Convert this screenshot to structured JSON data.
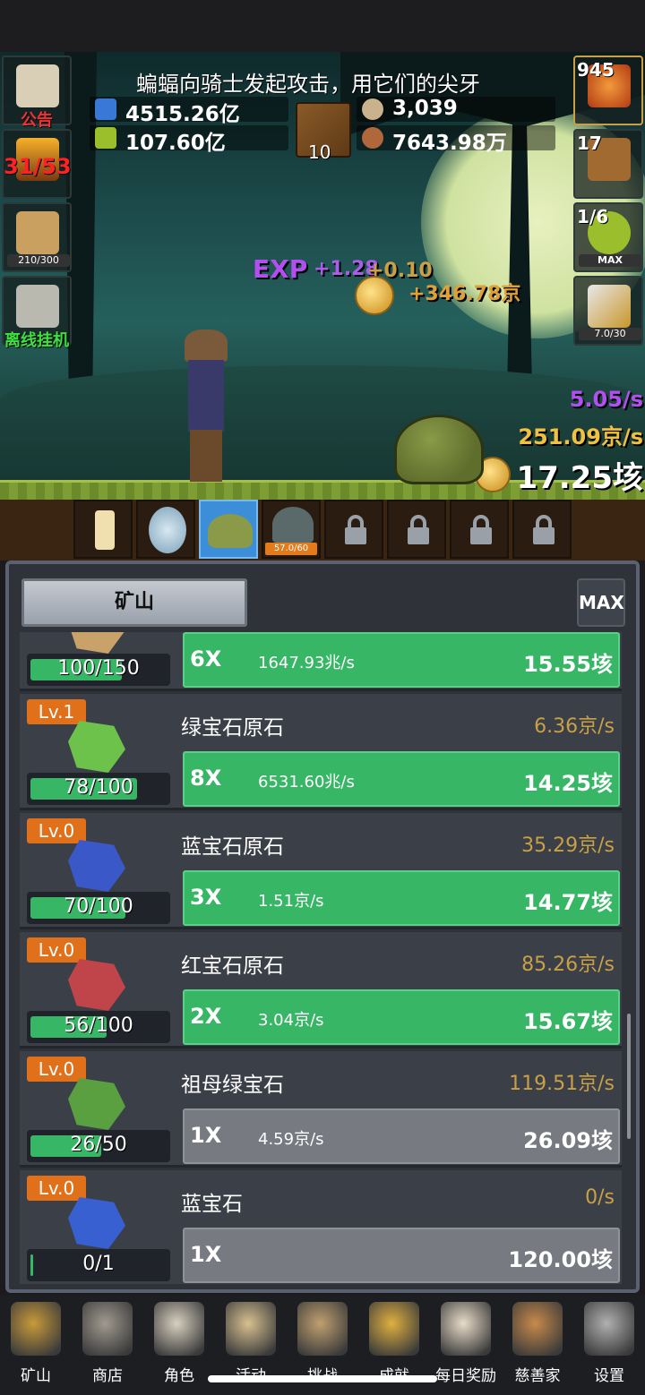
{
  "scene": {
    "message": "蝙蝠向骑士发起攻击，用它们的尖牙",
    "resources": [
      {
        "icon": "blue-potion-icon",
        "value": "4515.26亿"
      },
      {
        "icon": "green-potion-icon",
        "value": "107.60亿"
      },
      {
        "icon": "coin-icon",
        "value": "3,039"
      },
      {
        "icon": "meat-icon",
        "value": "7643.98万"
      }
    ],
    "book_count": "10",
    "left_buttons": [
      {
        "icon": "scroll-icon",
        "label": "公告"
      },
      {
        "icon": "torch-icon",
        "label": "31/53"
      },
      {
        "icon": "beer-icon",
        "label": "210/300"
      },
      {
        "icon": "key-icon",
        "label": "离线挂机"
      }
    ],
    "right_buttons": [
      {
        "icon": "potion-icon",
        "label": "945"
      },
      {
        "icon": "chest-icon",
        "label": "17"
      },
      {
        "icon": "slime-icon",
        "label": "1/6",
        "sub": "MAX"
      },
      {
        "icon": "sword-icon",
        "label": "7.0/30"
      }
    ],
    "floating": {
      "exp_label": "EXP",
      "exp_gain": "+1.28",
      "coin_gain": "+0.10",
      "gold_gain": "+346.78京"
    },
    "rates": {
      "exp_rate": "5.05/s",
      "gold_rate": "251.09京/s",
      "total": "17.25垓"
    },
    "monsters": [
      {
        "name": "candle",
        "locked": false,
        "active": false
      },
      {
        "name": "egg",
        "locked": false,
        "active": false
      },
      {
        "name": "slime",
        "locked": false,
        "active": true
      },
      {
        "name": "ghost",
        "locked": false,
        "active": false,
        "hp": "57.0/60"
      },
      {
        "name": "locked",
        "locked": true
      },
      {
        "name": "locked",
        "locked": true
      },
      {
        "name": "locked",
        "locked": true
      },
      {
        "name": "locked",
        "locked": true
      }
    ]
  },
  "panel": {
    "tab_label": "矿山",
    "max_label": "MAX",
    "rows": [
      {
        "lv": "",
        "name": "",
        "rate": "",
        "progress": "100/150",
        "progress_frac": 0.67,
        "mult": "6X",
        "per": "1647.93兆/s",
        "cost": "15.55垓",
        "state": "green",
        "gem_color": "#c9a26a"
      },
      {
        "lv": "Lv.1",
        "name": "绿宝石原石",
        "rate": "6.36京/s",
        "progress": "78/100",
        "progress_frac": 0.78,
        "mult": "8X",
        "per": "6531.60兆/s",
        "cost": "14.25垓",
        "state": "green",
        "gem_color": "#6cc24a"
      },
      {
        "lv": "Lv.0",
        "name": "蓝宝石原石",
        "rate": "35.29京/s",
        "progress": "70/100",
        "progress_frac": 0.7,
        "mult": "3X",
        "per": "1.51京/s",
        "cost": "14.77垓",
        "state": "green",
        "gem_color": "#3a58c8"
      },
      {
        "lv": "Lv.0",
        "name": "红宝石原石",
        "rate": "85.26京/s",
        "progress": "56/100",
        "progress_frac": 0.56,
        "mult": "2X",
        "per": "3.04京/s",
        "cost": "15.67垓",
        "state": "green",
        "gem_color": "#c0454a"
      },
      {
        "lv": "Lv.0",
        "name": "祖母绿宝石",
        "rate": "119.51京/s",
        "progress": "26/50",
        "progress_frac": 0.52,
        "mult": "1X",
        "per": "4.59京/s",
        "cost": "26.09垓",
        "state": "gray",
        "gem_color": "#5aa040"
      },
      {
        "lv": "Lv.0",
        "name": "蓝宝石",
        "rate": "0/s",
        "progress": "0/1",
        "progress_frac": 0.02,
        "mult": "1X",
        "per": "",
        "cost": "120.00垓",
        "state": "gray",
        "gem_color": "#3860d0"
      }
    ]
  },
  "nav": [
    {
      "icon": "lantern-icon",
      "label": "矿山"
    },
    {
      "icon": "shop-icon",
      "label": "商店"
    },
    {
      "icon": "skull-icon",
      "label": "角色"
    },
    {
      "icon": "scroll-icon",
      "label": "活动"
    },
    {
      "icon": "map-icon",
      "label": "挑战"
    },
    {
      "icon": "key-icon",
      "label": "成就"
    },
    {
      "icon": "letter-icon",
      "label": "每日奖励"
    },
    {
      "icon": "bread-icon",
      "label": "慈善家"
    },
    {
      "icon": "gear-icon",
      "label": "设置"
    }
  ]
}
